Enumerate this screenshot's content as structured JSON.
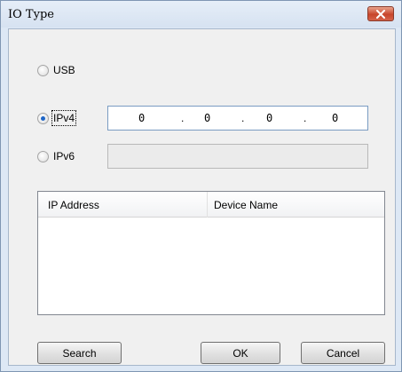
{
  "window": {
    "title": "IO Type"
  },
  "io_options": {
    "usb_label": "USB",
    "ipv4_label": "IPv4",
    "ipv6_label": "IPv6",
    "selected": "IPv4"
  },
  "ipv4": {
    "octets": [
      "0",
      "0",
      "0",
      "0"
    ],
    "separator": "."
  },
  "ipv6": {
    "value": ""
  },
  "device_list": {
    "columns": [
      "IP Address",
      "Device Name"
    ],
    "rows": []
  },
  "buttons": {
    "search": "Search",
    "ok": "OK",
    "cancel": "Cancel"
  },
  "icons": {
    "close": "close-icon"
  },
  "colors": {
    "titlebar": "#dde8f5",
    "close_button": "#c8452b",
    "selected_radio": "#1f66c6"
  }
}
